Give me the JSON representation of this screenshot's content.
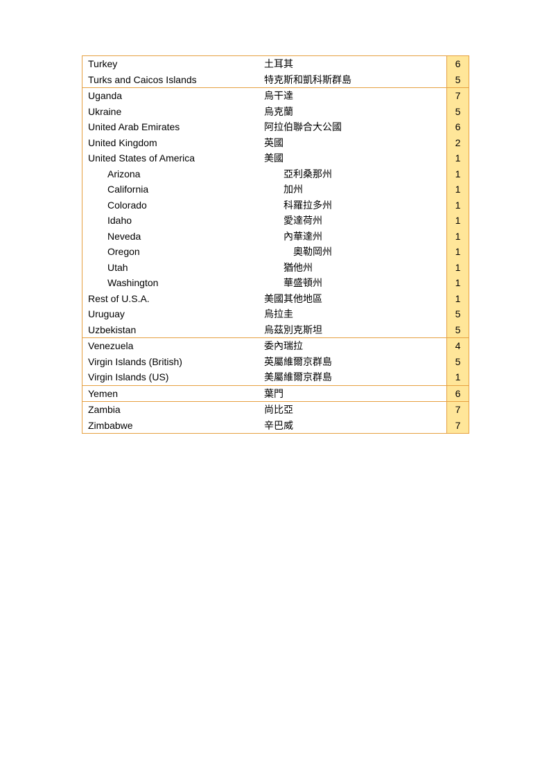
{
  "rows": [
    {
      "en": "Turkey",
      "zh": "土耳其",
      "val": "6",
      "indent": false,
      "zhIndent": 0,
      "sep": false
    },
    {
      "en": "Turks and Caicos Islands",
      "zh": "特克斯和凱科斯群島",
      "val": "5",
      "indent": false,
      "zhIndent": 0,
      "sep": false
    },
    {
      "en": "Uganda",
      "zh": "烏干達",
      "val": "7",
      "indent": false,
      "zhIndent": 0,
      "sep": true
    },
    {
      "en": "Ukraine",
      "zh": "烏克蘭",
      "val": "5",
      "indent": false,
      "zhIndent": 0,
      "sep": false
    },
    {
      "en": "United Arab Emirates",
      "zh": "阿拉伯聯合大公國",
      "val": "6",
      "indent": false,
      "zhIndent": 0,
      "sep": false
    },
    {
      "en": "United Kingdom",
      "zh": "英國",
      "val": "2",
      "indent": false,
      "zhIndent": 0,
      "sep": false
    },
    {
      "en": "United States of America",
      "zh": "美國",
      "val": "1",
      "indent": false,
      "zhIndent": 0,
      "sep": false
    },
    {
      "en": "Arizona",
      "zh": "亞利桑那州",
      "val": "1",
      "indent": true,
      "zhIndent": 1,
      "sep": false
    },
    {
      "en": "California",
      "zh": "加州",
      "val": "1",
      "indent": true,
      "zhIndent": 1,
      "sep": false
    },
    {
      "en": "Colorado",
      "zh": "科羅拉多州",
      "val": "1",
      "indent": true,
      "zhIndent": 1,
      "sep": false
    },
    {
      "en": "Idaho",
      "zh": "愛達荷州",
      "val": "1",
      "indent": true,
      "zhIndent": 1,
      "sep": false
    },
    {
      "en": "Neveda",
      "zh": "內華達州",
      "val": "1",
      "indent": true,
      "zhIndent": 1,
      "sep": false
    },
    {
      "en": "Oregon",
      "zh": "奧勒岡州",
      "val": "1",
      "indent": true,
      "zhIndent": 2,
      "sep": false
    },
    {
      "en": "Utah",
      "zh": "猶他州",
      "val": "1",
      "indent": true,
      "zhIndent": 1,
      "sep": false
    },
    {
      "en": "Washington",
      "zh": "華盛頓州",
      "val": "1",
      "indent": true,
      "zhIndent": 1,
      "sep": false
    },
    {
      "en": "Rest of U.S.A.",
      "zh": "美國其他地區",
      "val": "1",
      "indent": false,
      "zhIndent": 0,
      "sep": false
    },
    {
      "en": "Uruguay",
      "zh": "烏拉圭",
      "val": "5",
      "indent": false,
      "zhIndent": 0,
      "sep": false
    },
    {
      "en": "Uzbekistan",
      "zh": "烏茲別克斯坦",
      "val": "5",
      "indent": false,
      "zhIndent": 0,
      "sep": false
    },
    {
      "en": "Venezuela",
      "zh": "委內瑞拉",
      "val": "4",
      "indent": false,
      "zhIndent": 0,
      "sep": true
    },
    {
      "en": "Virgin Islands (British)",
      "zh": "英屬維爾京群島",
      "val": "5",
      "indent": false,
      "zhIndent": 0,
      "sep": false
    },
    {
      "en": "Virgin Islands (US)",
      "zh": "美屬維爾京群島",
      "val": "1",
      "indent": false,
      "zhIndent": 0,
      "sep": false
    },
    {
      "en": "Yemen",
      "zh": "葉門",
      "val": "6",
      "indent": false,
      "zhIndent": 0,
      "sep": true
    },
    {
      "en": "Zambia",
      "zh": "尚比亞",
      "val": "7",
      "indent": false,
      "zhIndent": 0,
      "sep": true
    },
    {
      "en": "Zimbabwe",
      "zh": "辛巴威",
      "val": "7",
      "indent": false,
      "zhIndent": 0,
      "sep": false
    }
  ]
}
